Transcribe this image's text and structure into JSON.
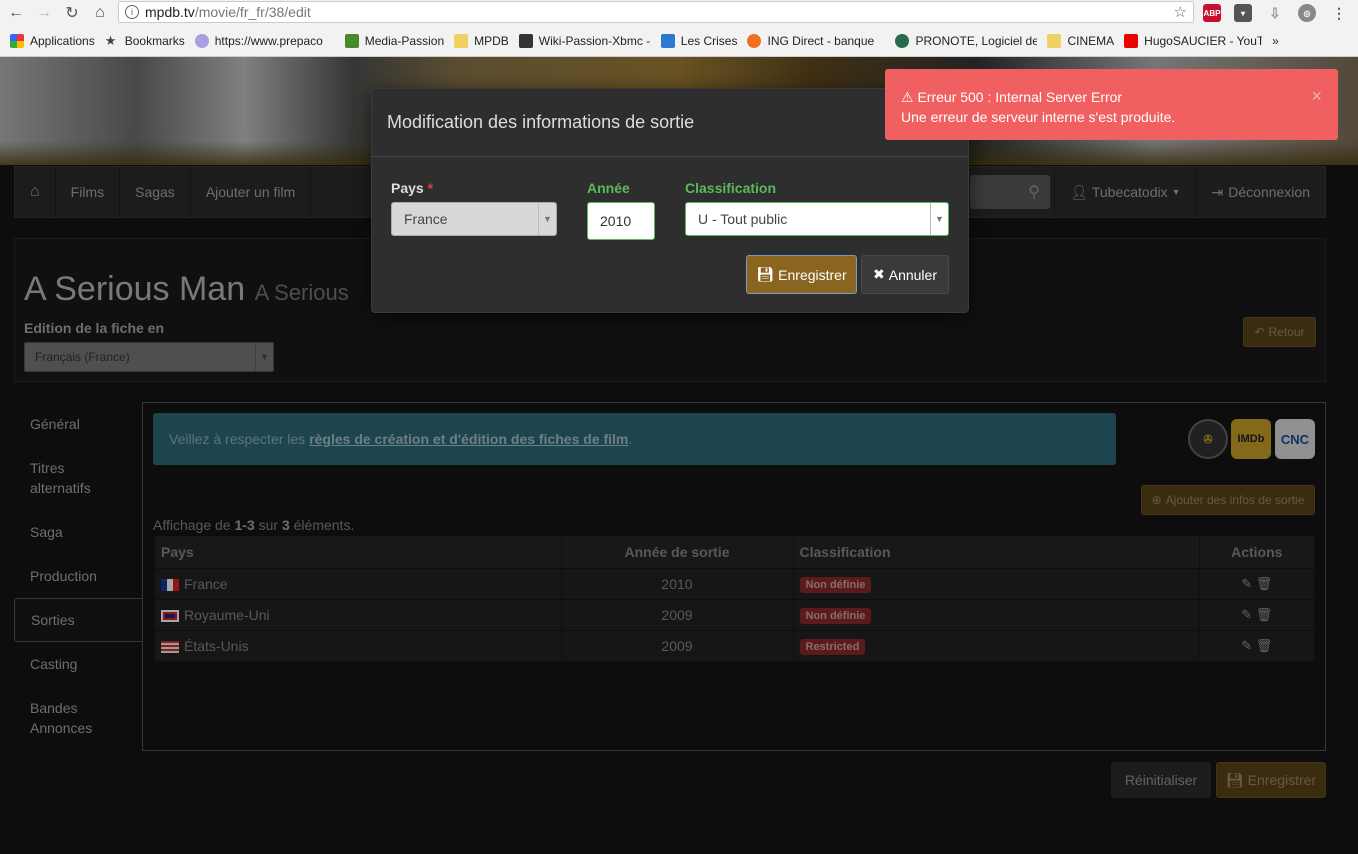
{
  "browser": {
    "url_host": "mpdb.tv",
    "url_path": "/movie/fr_fr/38/edit",
    "bookmarks": [
      "Applications",
      "Bookmarks",
      "https://www.prepaco",
      "Media-Passion",
      "MPDB",
      "Wiki-Passion-Xbmc -",
      "Les Crises",
      "ING Direct - banque",
      "PRONOTE, Logiciel de",
      "CINEMA",
      "HugoSAUCIER - YouT"
    ],
    "more": "»",
    "ext_abp": "ABP"
  },
  "nav": {
    "home_icon": "home-icon",
    "items": [
      "Films",
      "Sagas",
      "Ajouter un film"
    ],
    "user": "Tubecatodix",
    "logout": "Déconnexion"
  },
  "movie": {
    "title": "A Serious Man",
    "subtitle": "A Serious",
    "edit_label": "Edition de la fiche en",
    "language": "Français (France)",
    "back_label": "Retour"
  },
  "sidebar": [
    "Général",
    "Titres alternatifs",
    "Saga",
    "Production",
    "Sorties",
    "Casting",
    "Bandes Annonces"
  ],
  "content": {
    "info_prefix": "Veillez à respecter les",
    "info_link": "règles de création et d'édition des fiches de film",
    "info_suffix": ".",
    "logos": [
      "AlloCiné",
      "IMDb",
      "CNC"
    ],
    "add_button": "Ajouter des infos de sortie",
    "summary_prefix": "Affichage de",
    "summary_range": "1-3",
    "summary_mid": "sur",
    "summary_total": "3",
    "summary_suffix": "éléments.",
    "columns": [
      "Pays",
      "Année de sortie",
      "Classification",
      "Actions"
    ],
    "rows": [
      {
        "country": "France",
        "year": "2010",
        "rating": "Non définie"
      },
      {
        "country": "Royaume-Uni",
        "year": "2009",
        "rating": "Non définie"
      },
      {
        "country": "États-Unis",
        "year": "2009",
        "rating": "Restricted"
      }
    ],
    "reset_button": "Réinitialiser",
    "save_button": "Enregistrer"
  },
  "modal": {
    "title": "Modification des informations de sortie",
    "pays_label": "Pays",
    "required_mark": "*",
    "pays_value": "France",
    "annee_label": "Année",
    "annee_value": "2010",
    "classification_label": "Classification",
    "classification_value": "U - Tout public",
    "save_label": "Enregistrer",
    "cancel_label": "Annuler"
  },
  "toast": {
    "title": "Erreur 500 : Internal Server Error",
    "message": "Une erreur de serveur interne s'est produite.",
    "close": "×"
  },
  "colors": {
    "accent": "#8a6520",
    "error": "#f06060",
    "info": "#2e6a7a",
    "success_label": "#5cb85c"
  }
}
